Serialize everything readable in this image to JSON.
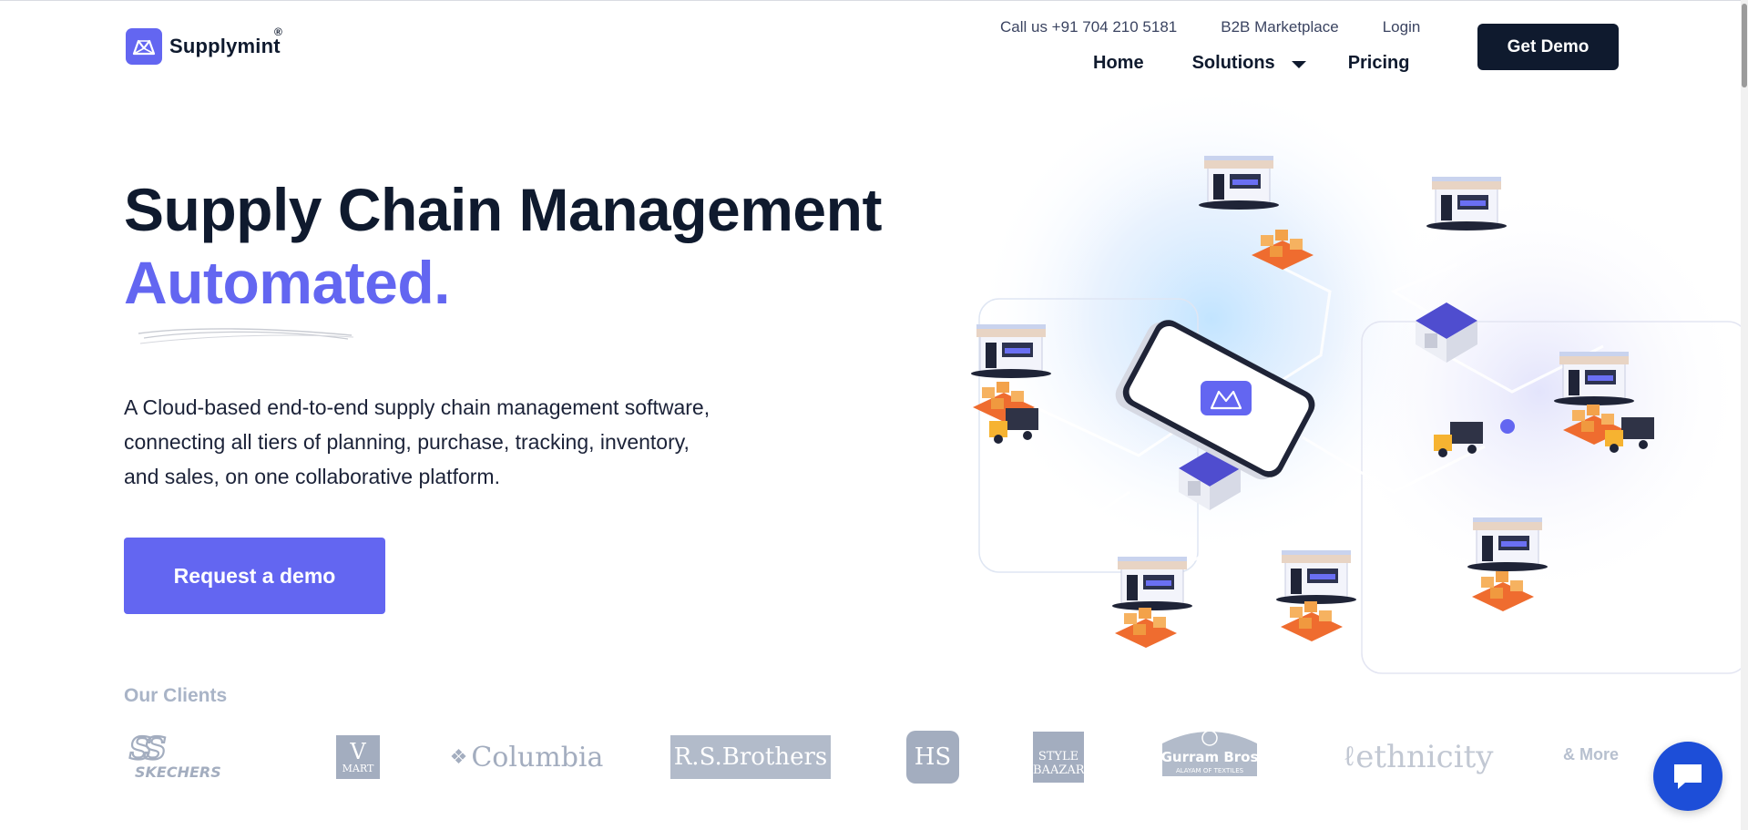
{
  "brand": {
    "name": "Supplymint",
    "registered": "®",
    "accent_color": "#6366f1",
    "dark_color": "#0f1a2e"
  },
  "topbar": {
    "call": "Call us +91 704 210 5181",
    "marketplace": "B2B Marketplace",
    "login": "Login"
  },
  "nav": {
    "home": "Home",
    "solutions": "Solutions",
    "pricing": "Pricing",
    "get_demo": "Get Demo"
  },
  "hero": {
    "title": "Supply Chain Management",
    "accent": "Automated.",
    "description_lines": [
      "A Cloud-based end-to-end supply chain management software,",
      "connecting all tiers of planning, purchase, tracking, inventory,",
      "and sales, on one collaborative platform."
    ],
    "cta": "Request a demo"
  },
  "clients": {
    "label": "Our Clients",
    "logos": [
      {
        "name": "skechers",
        "text": "SKECHERS"
      },
      {
        "name": "vmart",
        "text": "V MART"
      },
      {
        "name": "columbia",
        "text": "Columbia"
      },
      {
        "name": "rs-brothers",
        "text": "R.S.Brothers"
      },
      {
        "name": "hs",
        "text": "HS"
      },
      {
        "name": "style-baazar",
        "text": "STYLE BAAZAR"
      },
      {
        "name": "gurram-bros",
        "text": "Gurram Bros",
        "subtext": "ALAYAM OF TEXTILES"
      },
      {
        "name": "ethnicity",
        "text": "ethnicity"
      }
    ],
    "more": "& More"
  },
  "icons": {
    "logo": "supplymint-logo-icon",
    "caret": "chevron-down-icon",
    "chat": "chat-icon"
  }
}
